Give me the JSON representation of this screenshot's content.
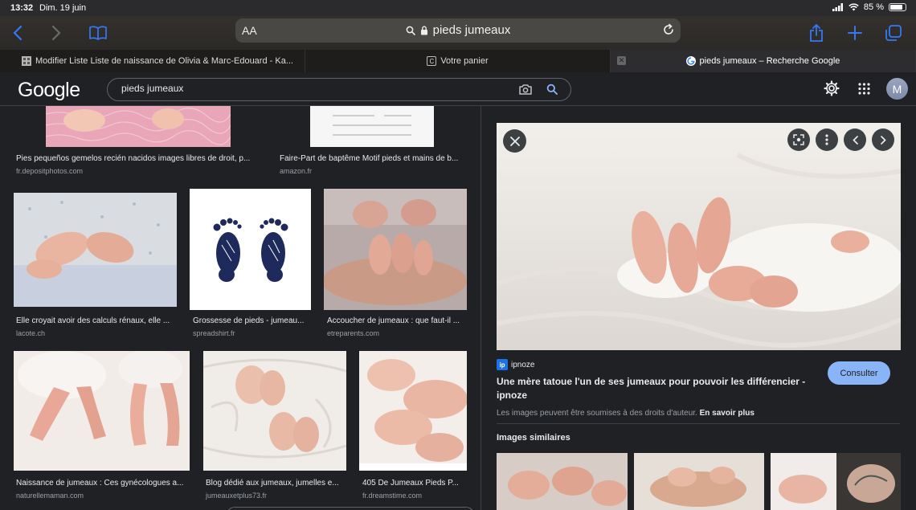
{
  "status": {
    "time": "13:32",
    "date": "Dim. 19 juin",
    "battery": "85 %",
    "battery_level": 0.85
  },
  "toolbar": {
    "text_size": "AA",
    "address": "pieds jumeaux"
  },
  "tabs": [
    {
      "label": "Modifier Liste Liste de naissance de Olivia & Marc-Edouard - Ka..."
    },
    {
      "label": "Votre panier",
      "favicon": "C"
    },
    {
      "label": "pieds jumeaux – Recherche Google"
    }
  ],
  "google": {
    "logo": "Google",
    "query": "pieds jumeaux",
    "avatar": "M"
  },
  "results": [
    {
      "caption": "Pies pequeños gemelos recién nacidos images libres de droit, p...",
      "source": "fr.depositphotos.com"
    },
    {
      "caption": "Faire-Part de baptême Motif pieds et mains de b...",
      "source": "amazon.fr"
    },
    {
      "caption": "Elle croyait avoir des calculs rénaux, elle ...",
      "source": "lacote.ch"
    },
    {
      "caption": "Grossesse de pieds - jumeau...",
      "source": "spreadshirt.fr"
    },
    {
      "caption": "Accoucher de jumeaux : que faut-il ...",
      "source": "etreparents.com"
    },
    {
      "caption": "Naissance de jumeaux : Ces gynécologues a...",
      "source": "naturellemaman.com"
    },
    {
      "caption": "Blog dédié aux jumeaux, jumelles e...",
      "source": "jumeauxetplus73.fr"
    },
    {
      "caption": "405 De Jumeaux Pieds P...",
      "source": "fr.dreamstime.com"
    }
  ],
  "panel": {
    "site_name": "ipnoze",
    "site_logo": "ip",
    "title": "Une mère tatoue l'un de ses jumeaux pour pouvoir les différencier - ipnoze",
    "visit_button": "Consulter",
    "rights_text": "Les images peuvent être soumises à des droits d'auteur.",
    "rights_link": "En savoir plus",
    "similar_title": "Images similaires"
  },
  "colors": {
    "background": "#202124",
    "accent": "#8ab4f8",
    "safari_blue": "#3478f6"
  }
}
